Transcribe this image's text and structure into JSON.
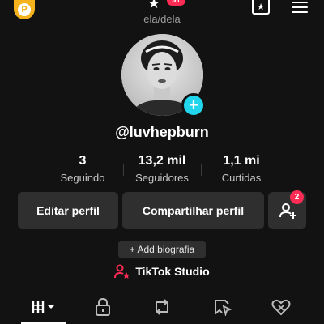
{
  "topbar": {
    "coin_icon": "coin-icon",
    "coin_symbol": "P",
    "star_glyph": "★",
    "notification_badge": "9+",
    "pronouns": "ela/dela",
    "favorites_icon": "favorites-icon",
    "menu_icon": "hamburger-menu-icon"
  },
  "profile": {
    "avatar_icon": "profile-photo",
    "add_photo_symbol": "+",
    "username": "@luvhepburn"
  },
  "stats": [
    {
      "value": "3",
      "label": "Seguindo"
    },
    {
      "value": "13,2 mil",
      "label": "Seguidores"
    },
    {
      "value": "1,1 mi",
      "label": "Curtidas"
    }
  ],
  "actions": {
    "edit_label": "Editar perfil",
    "share_label": "Compartilhar perfil",
    "friends_badge": "2"
  },
  "bio": {
    "add_label": "+ Add biografia"
  },
  "studio": {
    "label": "TikTok Studio"
  },
  "tabs": [
    {
      "icon": "videos-grid-icon",
      "active": true
    },
    {
      "icon": "lock-icon",
      "active": false
    },
    {
      "icon": "repost-icon",
      "active": false
    },
    {
      "icon": "saved-icon",
      "active": false
    },
    {
      "icon": "liked-icon",
      "active": false
    }
  ],
  "colors": {
    "background": "#121212",
    "button": "#2f2f2f",
    "accent_red": "#fe2c55",
    "accent_cyan": "#20d5ec",
    "coin": "#f6b21c"
  }
}
